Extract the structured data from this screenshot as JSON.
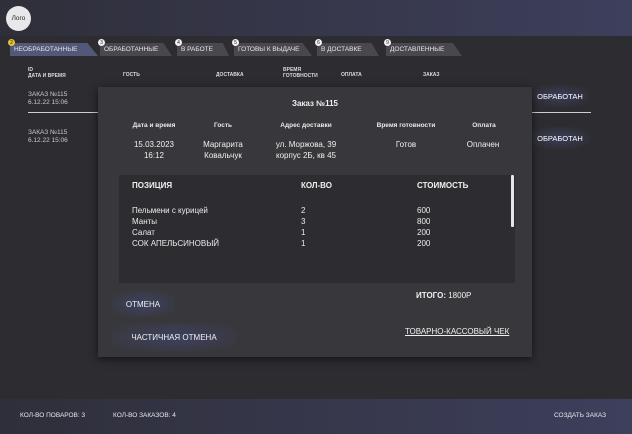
{
  "header": {
    "logo": "Лого"
  },
  "tabs": [
    {
      "label": "НЕОБРАБОТАННЫЕ",
      "badge": "2",
      "active": true
    },
    {
      "label": "ОБРАБОТАННЫЕ",
      "badge": "3",
      "active": false
    },
    {
      "label": "В РАБОТЕ",
      "badge": "4",
      "active": false
    },
    {
      "label": "ГОТОВЫ К ВЫДАЧЕ",
      "badge": "5",
      "active": false
    },
    {
      "label": "В ДОСТАВКЕ",
      "badge": "6",
      "active": false
    },
    {
      "label": "ДОСТАВЛЕННЫЕ",
      "badge": "9",
      "active": false
    }
  ],
  "table": {
    "headers": {
      "id": "ID",
      "datetime": "ДАТА И ВРЕМЯ",
      "guest": "ГОСТЬ",
      "delivery": "ДОСТАВКА",
      "ready_time_1": "ВРЕМЯ",
      "ready_time_2": "ГОТОВНОСТИ",
      "payment": "ОПЛАТА",
      "order": "ЗАКАЗ"
    },
    "rows": [
      {
        "id": "ЗАКАЗ №115",
        "datetime": "6.12.22 15:06",
        "action": "ОБРАБОТАН"
      },
      {
        "id": "ЗАКАЗ №115",
        "datetime": "6.12.22 15:06",
        "action": "ОБРАБОТАН"
      }
    ]
  },
  "modal": {
    "title": "Заказ №115",
    "headers": {
      "datetime": "Дата и время",
      "guest": "Гость",
      "address": "Адрес доставки",
      "ready_time": "Время готовности",
      "payment": "Оплата"
    },
    "values": {
      "date": "15.03.2023",
      "time": "16:12",
      "guest_first": "Маргарита",
      "guest_last": "Ковальчук",
      "address_1": "ул. Моржова, 39",
      "address_2": "корпус 2Б, кв 45",
      "ready_time": "Готов",
      "payment": "Оплачен"
    },
    "items_headers": {
      "position": "ПОЗИЦИЯ",
      "qty": "КОЛ-ВО",
      "cost": "СТОИМОСТЬ"
    },
    "items": [
      {
        "name": "Пельмени с курицей",
        "qty": "2",
        "cost": "600"
      },
      {
        "name": "Манты",
        "qty": "3",
        "cost": "800"
      },
      {
        "name": "Салат",
        "qty": "1",
        "cost": "200"
      },
      {
        "name": "СОК АПЕЛЬСИНОВЫЙ",
        "qty": "1",
        "cost": "200"
      }
    ],
    "total_label": "ИТОГО:",
    "total_value": "1800Р",
    "cancel": "ОТМЕНА",
    "partial_cancel": "ЧАСТИЧНАЯ ОТМЕНА",
    "receipt": "ТОВАРНО-КАССОВЫЙ ЧЕК"
  },
  "footer": {
    "cooks": "КОЛ-ВО ПОВАРОВ: 3",
    "orders": "КОЛ-ВО ЗАКАЗОВ: 4",
    "create": "СОЗДАТЬ ЗАКАЗ"
  }
}
